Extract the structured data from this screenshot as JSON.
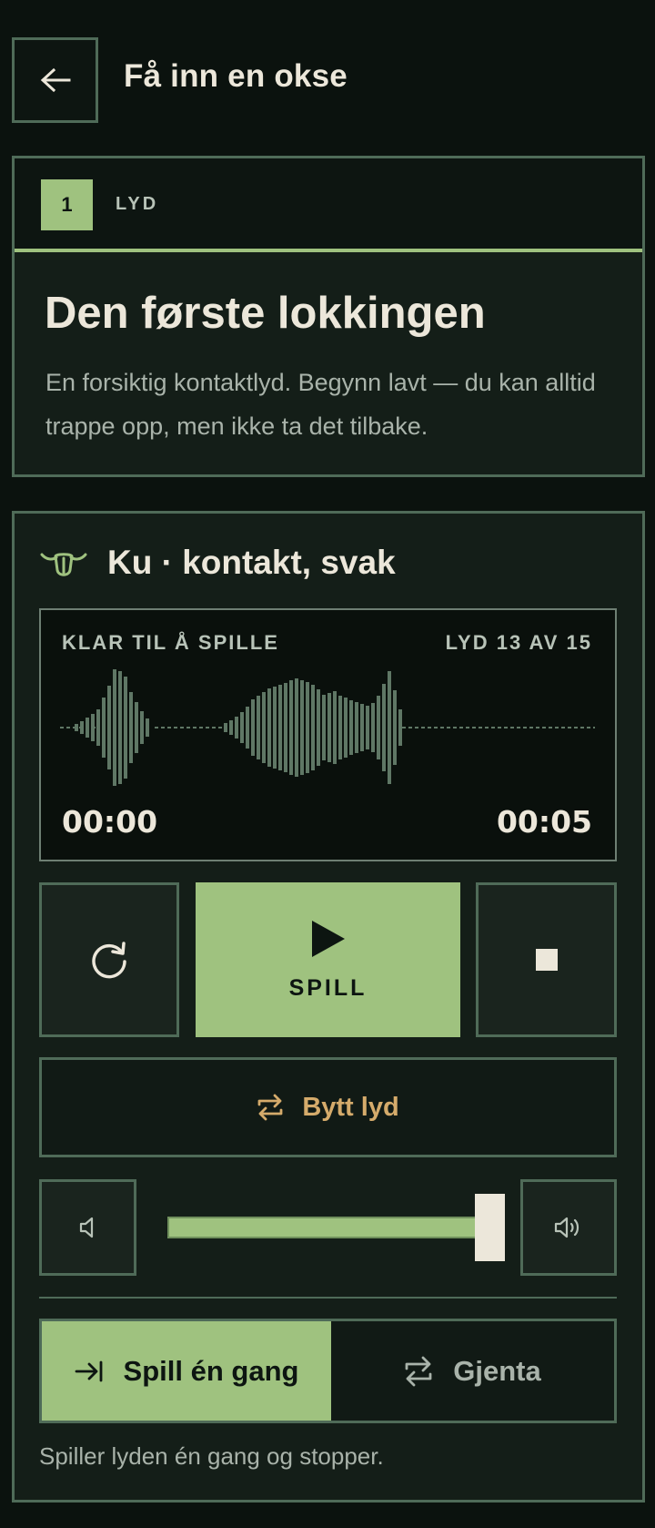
{
  "header": {
    "back_icon": "arrow-left-icon",
    "title": "Få inn en okse"
  },
  "step": {
    "number": "1",
    "kind": "LYD",
    "heading": "Den første lokkingen",
    "description": "En forsiktig kontaktlyd. Begynn lavt — du kan alltid trappe opp, men ikke ta det tilbake."
  },
  "player": {
    "sound_icon": "cow-head-icon",
    "sound_title": "Ku · kontakt, svak",
    "status": "KLAR TIL Å SPILLE",
    "counter": "LYD 13 AV 15",
    "time_current": "00:00",
    "time_total": "00:05",
    "replay_icon": "replay-icon",
    "play_icon": "play-icon",
    "play_label": "SPILL",
    "stop_icon": "stop-icon",
    "swap_icon": "swap-icon",
    "swap_label": "Bytt lyd",
    "volume_down_icon": "volume-down-icon",
    "volume_up_icon": "volume-up-icon",
    "volume_level": 0.95
  },
  "mode": {
    "once_icon": "arrow-to-line-icon",
    "once_label": "Spill én gang",
    "repeat_icon": "repeat-icon",
    "repeat_label": "Gjenta",
    "selected": "once",
    "description": "Spiller lyden én gang og stopper."
  },
  "colors": {
    "background": "#0b120e",
    "accent": "#9fc27f",
    "border": "#4f6b58",
    "swap": "#d5ab6b",
    "text": "#ece7da"
  }
}
